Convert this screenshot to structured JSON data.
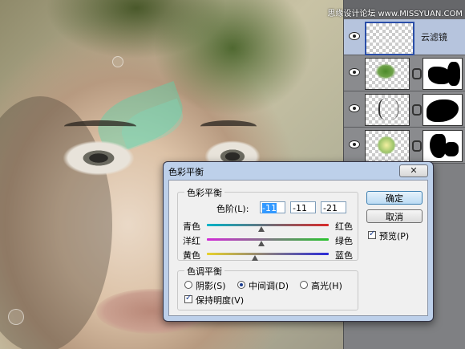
{
  "watermark": "思缘设计论坛 www.MISSYUAN.COM",
  "layers": [
    {
      "name": "云滤镜",
      "selected": true
    },
    {
      "name": "",
      "selected": false
    },
    {
      "name": "",
      "selected": false
    },
    {
      "name": "",
      "selected": false
    }
  ],
  "dialog": {
    "title": "色彩平衡",
    "close": "✕",
    "color_balance": {
      "group_title": "色彩平衡",
      "levels_label": "色阶(L):",
      "levels_values": [
        "-11",
        "-11",
        "-21"
      ],
      "sliders": [
        {
          "left": "青色",
          "right": "红色",
          "value": -11,
          "colors": [
            "#00b3c8",
            "#d82a2a"
          ]
        },
        {
          "left": "洋红",
          "right": "绿色",
          "value": -11,
          "colors": [
            "#d22ad8",
            "#29c42e"
          ]
        },
        {
          "left": "黄色",
          "right": "蓝色",
          "value": -21,
          "colors": [
            "#e8d22a",
            "#2a2ad8"
          ]
        }
      ]
    },
    "tone_balance": {
      "group_title": "色调平衡",
      "options": [
        {
          "label": "阴影(S)",
          "checked": false
        },
        {
          "label": "中间调(D)",
          "checked": true
        },
        {
          "label": "高光(H)",
          "checked": false
        }
      ],
      "preserve_luminosity": {
        "label": "保持明度(V)",
        "checked": true
      }
    },
    "buttons": {
      "ok": "确定",
      "cancel": "取消"
    },
    "preview": {
      "label": "预览(P)",
      "checked": true
    }
  }
}
